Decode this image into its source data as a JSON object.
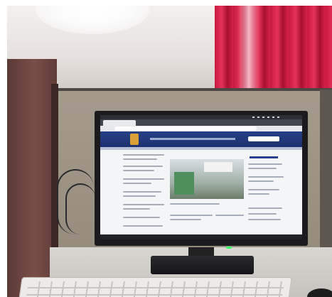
{
  "scene": {
    "description_subject": "computer-monitor-on-desk",
    "screen_site_header_color": "#263f86",
    "screen_accent_color": "#d9a03a",
    "curtain_color": "#d62249",
    "power_led_color": "#3bff6a"
  }
}
